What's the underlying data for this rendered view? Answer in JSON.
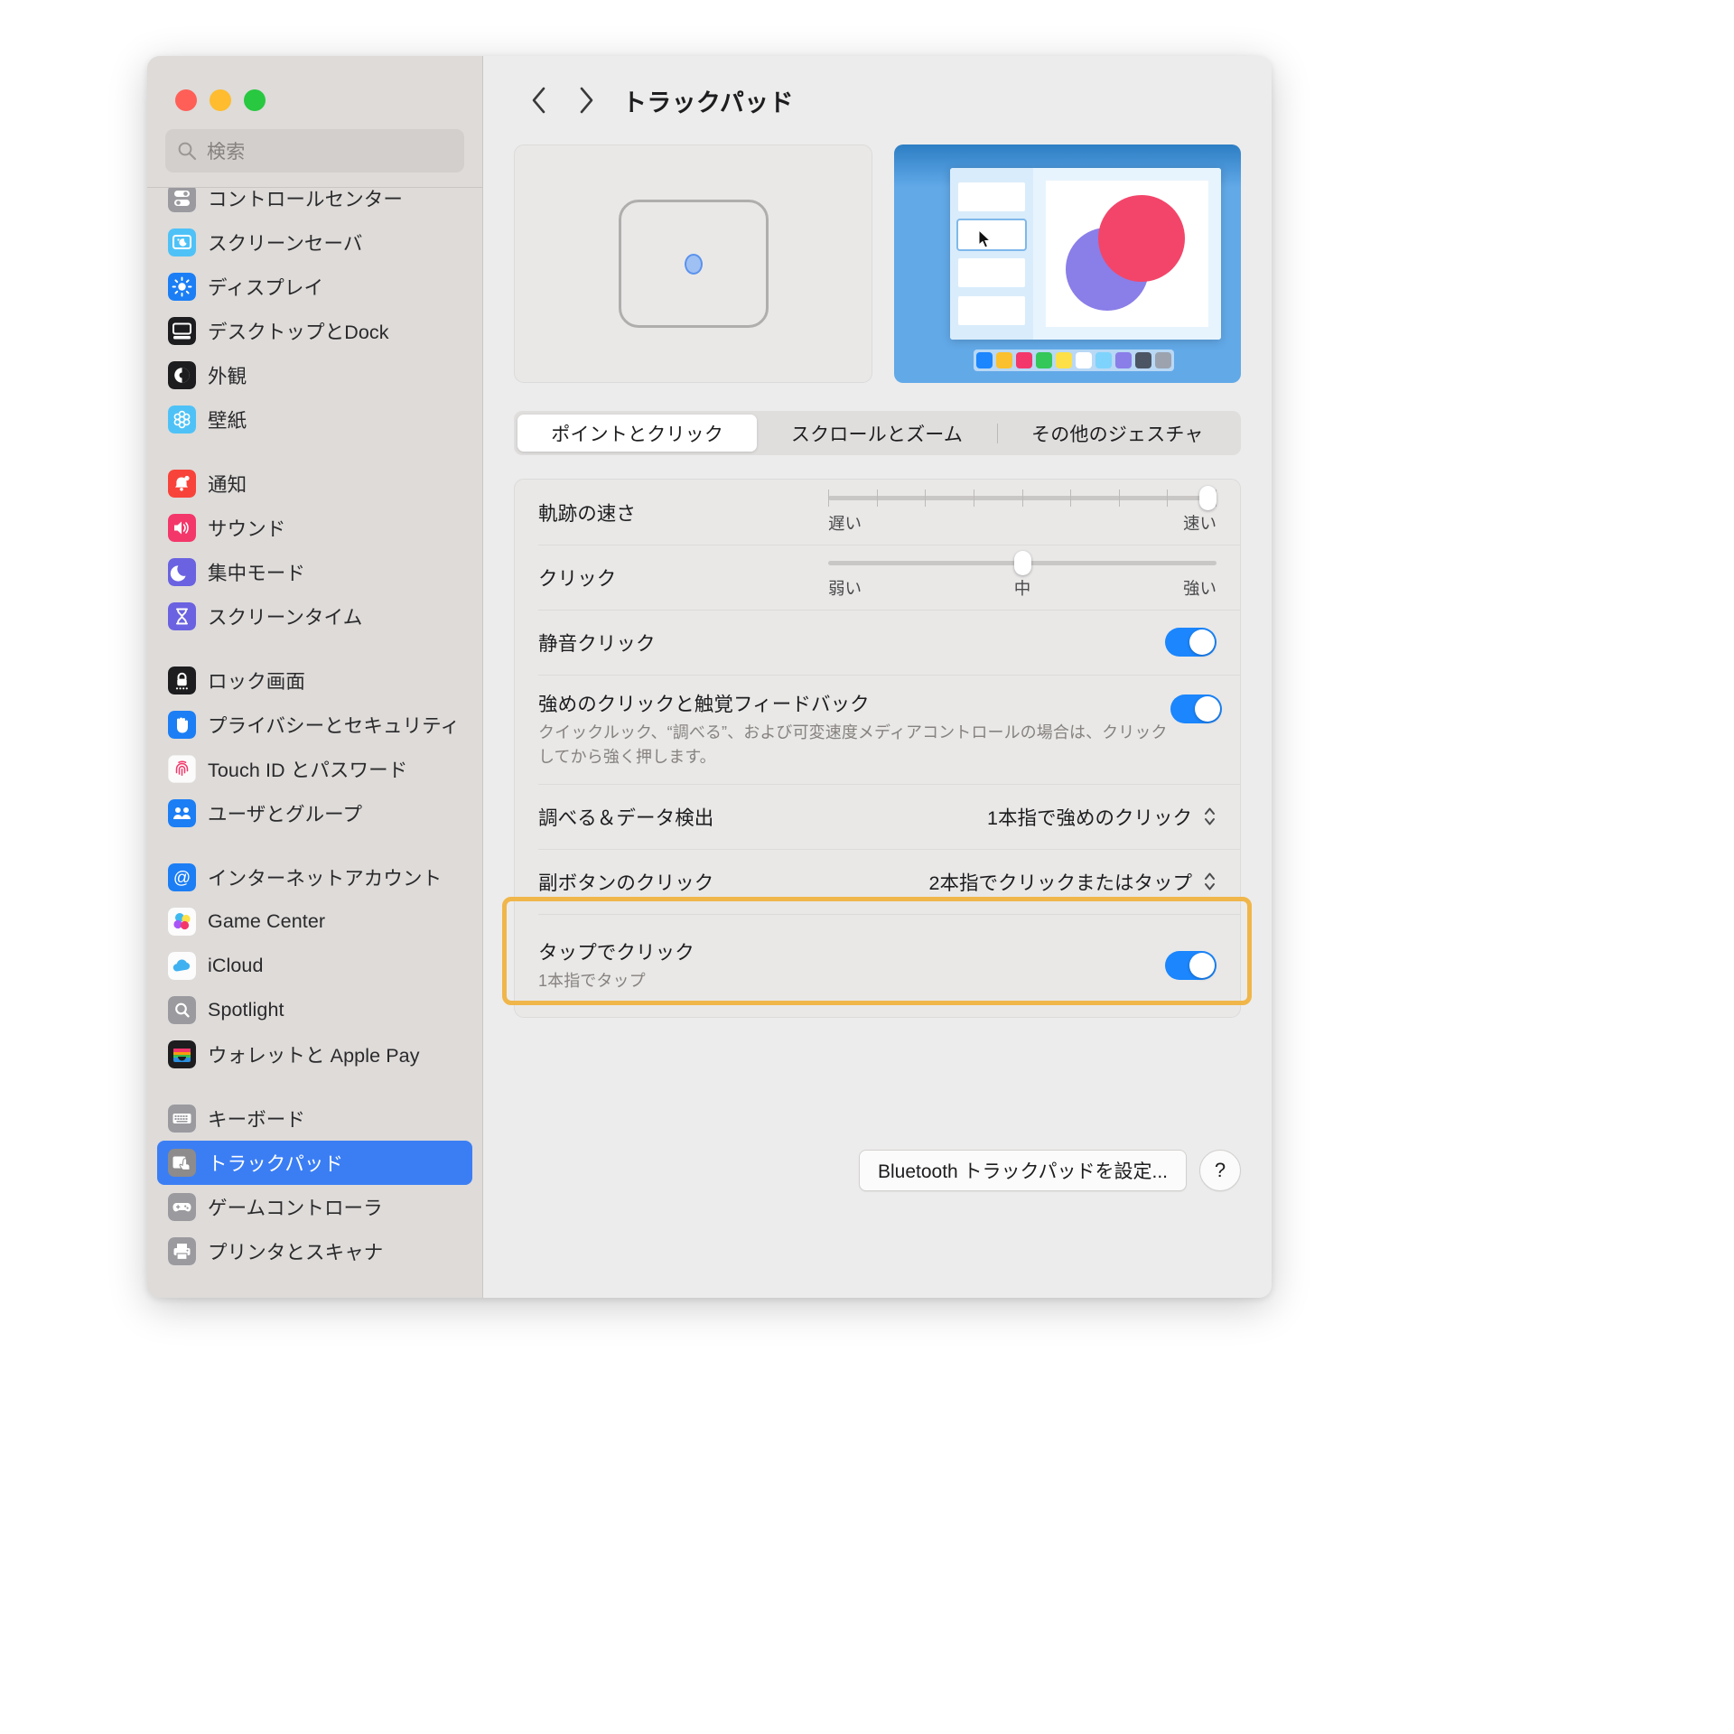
{
  "window": {
    "traffic_lights": [
      "close",
      "minimize",
      "zoom"
    ],
    "colors": {
      "close": "#ff5f57",
      "minimize": "#febc2e",
      "zoom": "#28c840",
      "accent": "#3b7ef4",
      "toggle_on": "#1b86fd",
      "highlight": "#f0b64a"
    }
  },
  "search": {
    "placeholder": "検索",
    "value": ""
  },
  "sidebar": {
    "groups": [
      {
        "items": [
          {
            "label": "コントロールセンター",
            "icon": "control-center-icon",
            "selected": false
          },
          {
            "label": "スクリーンセーバ",
            "icon": "screensaver-icon",
            "selected": false
          },
          {
            "label": "ディスプレイ",
            "icon": "display-icon",
            "selected": false
          },
          {
            "label": "デスクトップとDock",
            "icon": "desktop-dock-icon",
            "selected": false
          },
          {
            "label": "外観",
            "icon": "appearance-icon",
            "selected": false
          },
          {
            "label": "壁紙",
            "icon": "wallpaper-icon",
            "selected": false
          }
        ]
      },
      {
        "items": [
          {
            "label": "通知",
            "icon": "notifications-icon",
            "selected": false
          },
          {
            "label": "サウンド",
            "icon": "sound-icon",
            "selected": false
          },
          {
            "label": "集中モード",
            "icon": "focus-icon",
            "selected": false
          },
          {
            "label": "スクリーンタイム",
            "icon": "screen-time-icon",
            "selected": false
          }
        ]
      },
      {
        "items": [
          {
            "label": "ロック画面",
            "icon": "lock-screen-icon",
            "selected": false
          },
          {
            "label": "プライバシーとセキュリティ",
            "icon": "privacy-security-icon",
            "selected": false
          },
          {
            "label": "Touch ID とパスワード",
            "icon": "touch-id-icon",
            "selected": false
          },
          {
            "label": "ユーザとグループ",
            "icon": "users-groups-icon",
            "selected": false
          }
        ]
      },
      {
        "items": [
          {
            "label": "インターネットアカウント",
            "icon": "internet-accounts-icon",
            "selected": false
          },
          {
            "label": "Game Center",
            "icon": "game-center-icon",
            "selected": false
          },
          {
            "label": "iCloud",
            "icon": "icloud-icon",
            "selected": false
          },
          {
            "label": "Spotlight",
            "icon": "spotlight-icon",
            "selected": false
          },
          {
            "label": "ウォレットと Apple Pay",
            "icon": "wallet-applepay-icon",
            "selected": false
          }
        ]
      },
      {
        "items": [
          {
            "label": "キーボード",
            "icon": "keyboard-icon",
            "selected": false
          },
          {
            "label": "トラックパッド",
            "icon": "trackpad-icon",
            "selected": true
          },
          {
            "label": "ゲームコントローラ",
            "icon": "game-controller-icon",
            "selected": false
          },
          {
            "label": "プリンタとスキャナ",
            "icon": "printer-scanner-icon",
            "selected": false
          }
        ]
      }
    ]
  },
  "header": {
    "back_icon": "chevron-left-icon",
    "forward_icon": "chevron-right-icon",
    "title": "トラックパッド"
  },
  "preview": {
    "trackpad_graphic": "trackpad-outline-graphic",
    "video_graphic": "gesture-demo-video"
  },
  "tabs": [
    {
      "label": "ポイントとクリック",
      "active": true
    },
    {
      "label": "スクロールとズーム",
      "active": false
    },
    {
      "label": "その他のジェスチャ",
      "active": false
    }
  ],
  "settings": {
    "tracking_speed": {
      "label": "軌跡の速さ",
      "min_label": "遅い",
      "max_label": "速い",
      "value_percent": 100,
      "ticks": 9
    },
    "click": {
      "label": "クリック",
      "min_label": "弱い",
      "mid_label": "中",
      "max_label": "強い",
      "value_percent": 50,
      "ticks": 0
    },
    "silent_click": {
      "label": "静音クリック",
      "toggle": "on"
    },
    "force_click": {
      "label": "強めのクリックと触覚フィードバック",
      "description": "クイックルック、“調べる”、および可変速度メディアコントロールの場合は、クリックしてから強く押します。",
      "toggle": "on"
    },
    "lookup": {
      "label": "調べる＆データ検出",
      "value": "1本指で強めのクリック"
    },
    "secondary_click": {
      "label": "副ボタンのクリック",
      "value": "2本指でクリックまたはタップ"
    },
    "tap_to_click": {
      "label": "タップでクリック",
      "description": "1本指でタップ",
      "toggle": "on",
      "highlighted": true
    }
  },
  "footer": {
    "setup_button": "Bluetooth トラックパッドを設定...",
    "help_button": "?"
  }
}
